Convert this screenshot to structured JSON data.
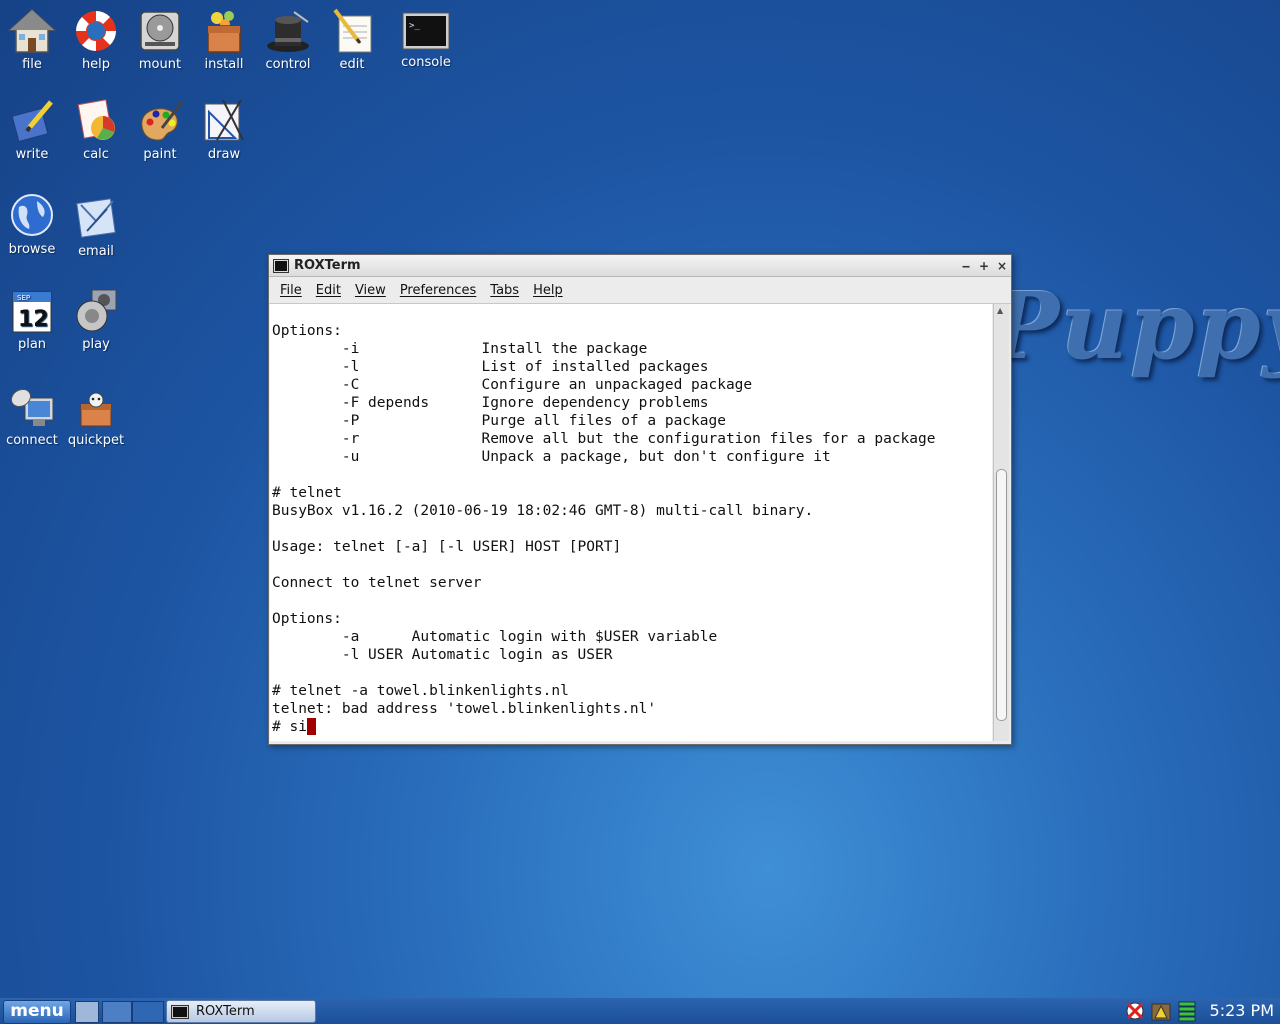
{
  "desktop": {
    "wallpaper_text": "Puppy",
    "icons": [
      {
        "label": "file",
        "icon": "home-icon"
      },
      {
        "label": "help",
        "icon": "lifebuoy-icon"
      },
      {
        "label": "mount",
        "icon": "drive-icon"
      },
      {
        "label": "install",
        "icon": "package-box-icon"
      },
      {
        "label": "control",
        "icon": "top-hat-icon"
      },
      {
        "label": "edit",
        "icon": "notepad-pencil-icon"
      },
      {
        "label": "console",
        "icon": "terminal-icon"
      },
      {
        "label": "write",
        "icon": "pen-notebook-icon"
      },
      {
        "label": "calc",
        "icon": "spreadsheet-icon"
      },
      {
        "label": "paint",
        "icon": "palette-icon"
      },
      {
        "label": "draw",
        "icon": "drafting-tools-icon"
      },
      {
        "label": "browse",
        "icon": "globe-icon"
      },
      {
        "label": "email",
        "icon": "envelope-icon"
      },
      {
        "label": "plan",
        "icon": "calendar-icon"
      },
      {
        "label": "play",
        "icon": "speaker-icon"
      },
      {
        "label": "connect",
        "icon": "network-dish-icon"
      },
      {
        "label": "quickpet",
        "icon": "pet-box-icon"
      }
    ],
    "calendar_month": "SEP",
    "calendar_day": "12"
  },
  "window": {
    "title": "ROXTerm",
    "controls": [
      "‒",
      "+",
      "×"
    ],
    "menu": [
      "File",
      "Edit",
      "View",
      "Preferences",
      "Tabs",
      "Help"
    ]
  },
  "terminal": {
    "lines": [
      "Options:",
      "        -i              Install the package",
      "        -l              List of installed packages",
      "        -C              Configure an unpackaged package",
      "        -F depends      Ignore dependency problems",
      "        -P              Purge all files of a package",
      "        -r              Remove all but the configuration files for a package",
      "        -u              Unpack a package, but don't configure it",
      "",
      "# telnet",
      "BusyBox v1.16.2 (2010-06-19 18:02:46 GMT-8) multi-call binary.",
      "",
      "Usage: telnet [-a] [-l USER] HOST [PORT]",
      "",
      "Connect to telnet server",
      "",
      "Options:",
      "        -a      Automatic login with $USER variable",
      "        -l USER Automatic login as USER",
      "",
      "# telnet -a towel.blinkenlights.nl",
      "telnet: bad address 'towel.blinkenlights.nl'"
    ],
    "prompt": "# si",
    "cursor_color": "#a00000"
  },
  "taskbar": {
    "menu_label": "menu",
    "task_label": "ROXTerm",
    "clock": "5:23 PM",
    "tray_icons": [
      "network-disabled-icon",
      "warning-shield-icon",
      "battery-stack-icon"
    ]
  }
}
